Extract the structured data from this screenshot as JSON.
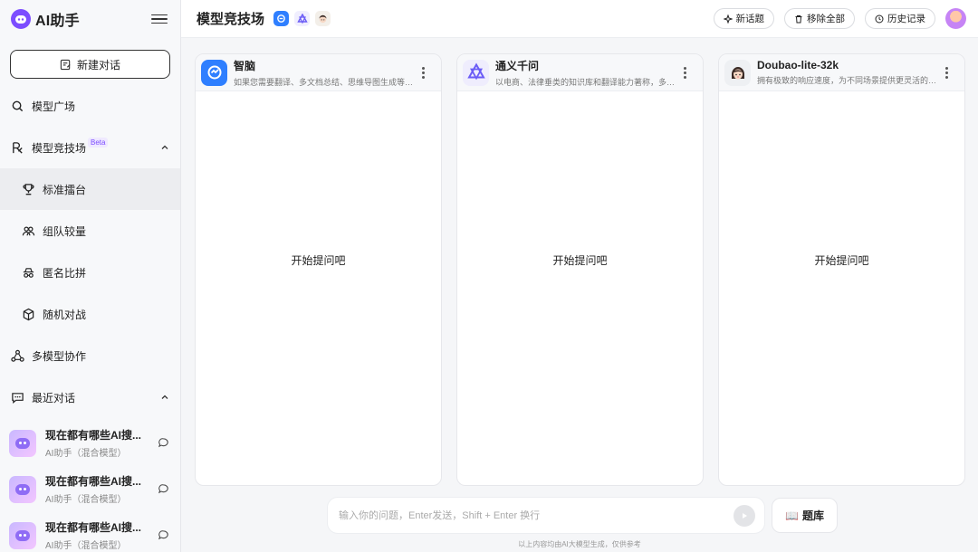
{
  "app": {
    "name": "AI助手"
  },
  "sidebar": {
    "new_chat": "新建对话",
    "items": [
      {
        "label": "模型广场"
      },
      {
        "label": "模型竞技场",
        "badge": "Beta"
      },
      {
        "label": "标准擂台"
      },
      {
        "label": "组队较量"
      },
      {
        "label": "匿名比拼"
      },
      {
        "label": "随机对战"
      },
      {
        "label": "多模型协作"
      },
      {
        "label": "最近对话"
      }
    ],
    "recent": [
      {
        "title": "现在都有哪些AI搜...",
        "subtitle": "AI助手（混合模型）"
      },
      {
        "title": "现在都有哪些AI搜...",
        "subtitle": "AI助手（混合模型）"
      },
      {
        "title": "现在都有哪些AI搜...",
        "subtitle": "AI助手（混合模型）"
      }
    ]
  },
  "header": {
    "title": "模型竞技场",
    "new_topic": "新话题",
    "remove_all": "移除全部",
    "history": "历史记录"
  },
  "panels": [
    {
      "name": "智脑",
      "desc": "如果您需要翻译、多文档总结、思维导图生成等方...",
      "empty": "开始提问吧"
    },
    {
      "name": "通义千问",
      "desc": "以电商、法律垂类的知识库和翻译能力著称，多模...",
      "empty": "开始提问吧"
    },
    {
      "name": "Doubao-lite-32k",
      "desc": "拥有极致的响应速度，为不同场景提供更灵活的选...",
      "empty": "开始提问吧"
    }
  ],
  "input": {
    "placeholder": "输入你的问题，Enter发送，Shift + Enter 换行"
  },
  "library_button": "题库",
  "footnote": "以上内容均由AI大模型生成，仅供参考",
  "colors": {
    "accent": "#7c4dff",
    "zhinao": "#2f7fff",
    "qwen": "#6b5cf6"
  }
}
